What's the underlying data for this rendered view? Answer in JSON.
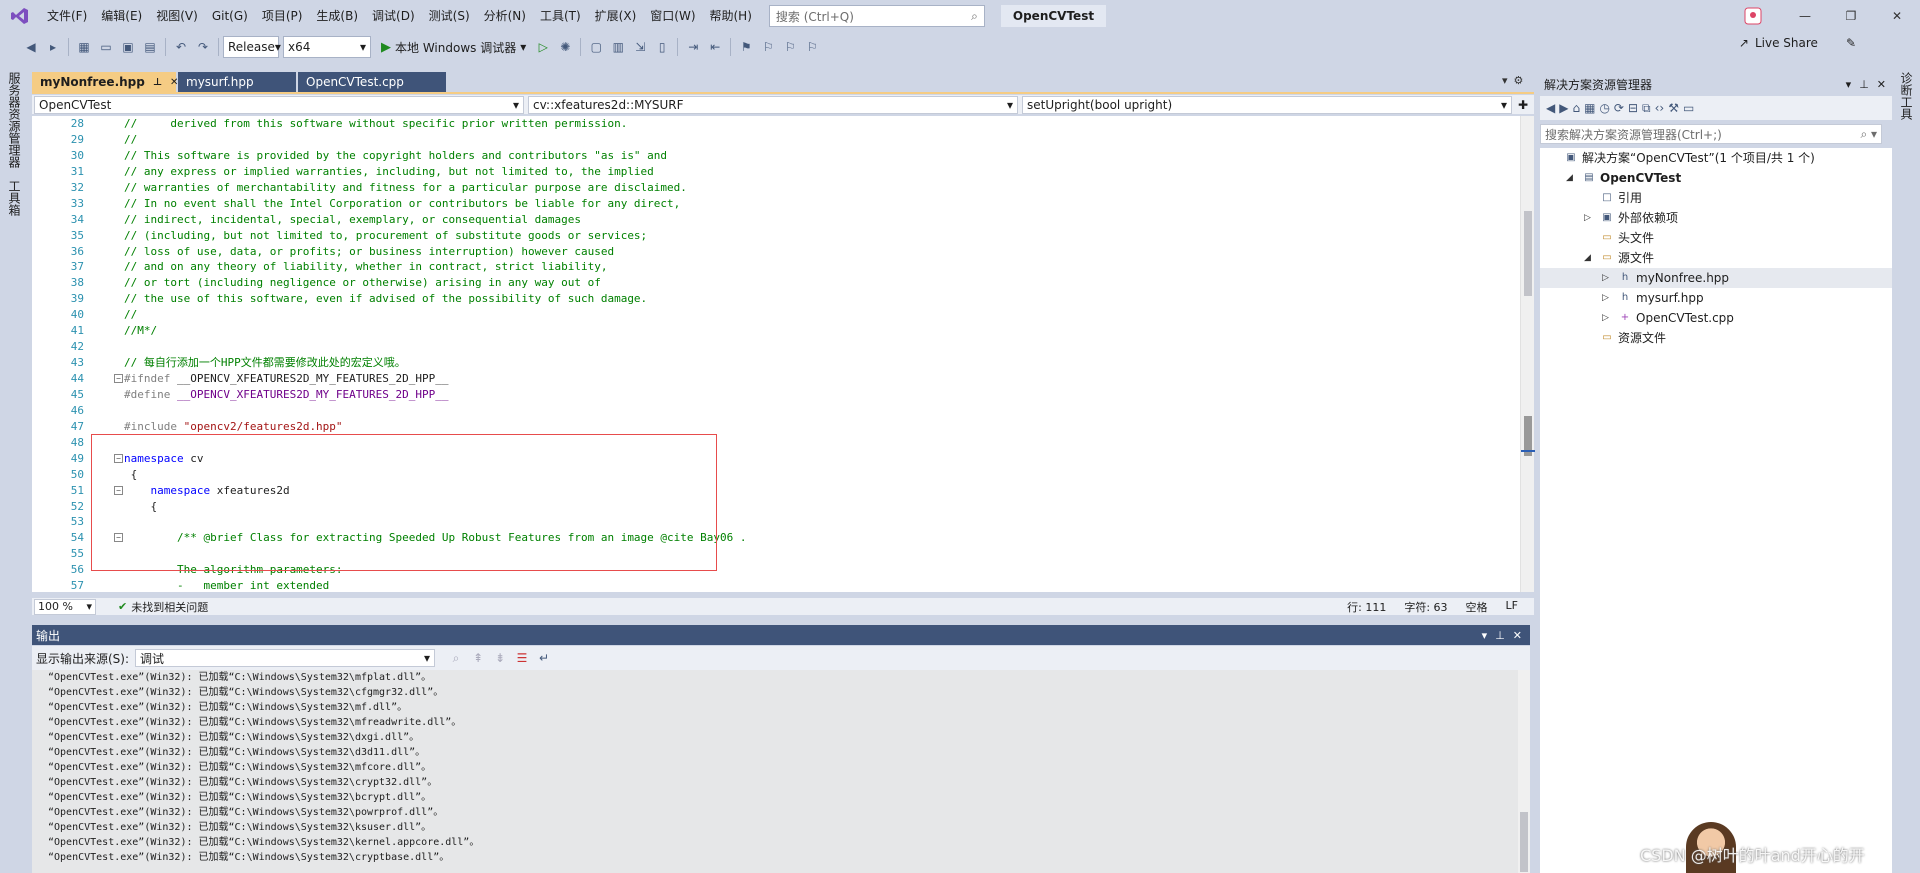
{
  "menubar": {
    "items": [
      "文件(F)",
      "编辑(E)",
      "视图(V)",
      "Git(G)",
      "项目(P)",
      "生成(B)",
      "调试(D)",
      "测试(S)",
      "分析(N)",
      "工具(T)",
      "扩展(X)",
      "窗口(W)",
      "帮助(H)"
    ],
    "search_placeholder": "搜索 (Ctrl+Q)",
    "solution_name": "OpenCVTest"
  },
  "toolbar": {
    "configuration": "Release",
    "platform": "x64",
    "run_label": "本地 Windows 调试器",
    "live_share": "Live Share"
  },
  "left_strip": {
    "tabs": [
      "服务器资源管理器",
      "工具箱"
    ]
  },
  "right_strip": {
    "tabs": [
      "诊断工具"
    ]
  },
  "editor": {
    "tabs": [
      {
        "label": "myNonfree.hpp",
        "active": true
      },
      {
        "label": "mysurf.hpp",
        "active": false
      },
      {
        "label": "OpenCVTest.cpp",
        "active": false
      }
    ],
    "nav": {
      "project": "OpenCVTest",
      "scope": "cv::xfeatures2d::MYSURF",
      "member": "setUpright(bool upright)"
    },
    "lines": [
      {
        "n": "28",
        "parts": [
          {
            "t": "//     derived from this software without specific prior written permission.",
            "c": "c-comment"
          }
        ]
      },
      {
        "n": "29",
        "parts": [
          {
            "t": "//",
            "c": "c-comment"
          }
        ]
      },
      {
        "n": "30",
        "parts": [
          {
            "t": "// This software is provided by the copyright holders and contributors \"as is\" and",
            "c": "c-comment"
          }
        ]
      },
      {
        "n": "31",
        "parts": [
          {
            "t": "// any express or implied warranties, including, but not limited to, the implied",
            "c": "c-comment"
          }
        ]
      },
      {
        "n": "32",
        "parts": [
          {
            "t": "// warranties of merchantability and fitness for a particular purpose are disclaimed.",
            "c": "c-comment"
          }
        ]
      },
      {
        "n": "33",
        "parts": [
          {
            "t": "// In no event shall the Intel Corporation or contributors be liable for any direct,",
            "c": "c-comment"
          }
        ]
      },
      {
        "n": "34",
        "parts": [
          {
            "t": "// indirect, incidental, special, exemplary, or consequential damages",
            "c": "c-comment"
          }
        ]
      },
      {
        "n": "35",
        "parts": [
          {
            "t": "// (including, but not limited to, procurement of substitute goods or services;",
            "c": "c-comment"
          }
        ]
      },
      {
        "n": "36",
        "parts": [
          {
            "t": "// loss of use, data, or profits; or business interruption) however caused",
            "c": "c-comment"
          }
        ]
      },
      {
        "n": "37",
        "parts": [
          {
            "t": "// and on any theory of liability, whether in contract, strict liability,",
            "c": "c-comment"
          }
        ]
      },
      {
        "n": "38",
        "parts": [
          {
            "t": "// or tort (including negligence or otherwise) arising in any way out of",
            "c": "c-comment"
          }
        ]
      },
      {
        "n": "39",
        "parts": [
          {
            "t": "// the use of this software, even if advised of the possibility of such damage.",
            "c": "c-comment"
          }
        ]
      },
      {
        "n": "40",
        "parts": [
          {
            "t": "//",
            "c": "c-comment"
          }
        ]
      },
      {
        "n": "41",
        "parts": [
          {
            "t": "//M*/",
            "c": "c-comment"
          }
        ]
      },
      {
        "n": "42",
        "parts": []
      },
      {
        "n": "43",
        "parts": [
          {
            "t": "// 每自行添加一个HPP文件都需要修改此处的宏定义哦。",
            "c": "c-comment"
          }
        ]
      },
      {
        "n": "44",
        "fold": "−",
        "parts": [
          {
            "t": "#ifndef ",
            "c": "c-pre"
          },
          {
            "t": "__OPENCV_XFEATURES2D_MY_FEATURES_2D_HPP__",
            "c": ""
          }
        ]
      },
      {
        "n": "45",
        "parts": [
          {
            "t": "#define ",
            "c": "c-pre"
          },
          {
            "t": "__OPENCV_XFEATURES2D_MY_FEATURES_2D_HPP__",
            "c": "c-macro"
          }
        ]
      },
      {
        "n": "46",
        "parts": []
      },
      {
        "n": "47",
        "parts": [
          {
            "t": "#include ",
            "c": "c-pre"
          },
          {
            "t": "\"opencv2/features2d.hpp\"",
            "c": "c-str"
          }
        ]
      },
      {
        "n": "48",
        "parts": []
      },
      {
        "n": "49",
        "fold": "−",
        "parts": [
          {
            "t": "namespace ",
            "c": "c-kw"
          },
          {
            "t": "cv",
            "c": ""
          }
        ]
      },
      {
        "n": "50",
        "parts": [
          {
            "t": " {",
            "c": ""
          }
        ]
      },
      {
        "n": "51",
        "fold": "−",
        "parts": [
          {
            "t": "    namespace ",
            "c": "c-kw"
          },
          {
            "t": "xfeatures2d",
            "c": ""
          }
        ]
      },
      {
        "n": "52",
        "parts": [
          {
            "t": "    {",
            "c": ""
          }
        ]
      },
      {
        "n": "53",
        "parts": []
      },
      {
        "n": "54",
        "fold": "−",
        "parts": [
          {
            "t": "        /** @brief Class for extracting Speeded Up Robust Features from an image @cite Bay06 .",
            "c": "c-doc"
          }
        ]
      },
      {
        "n": "55",
        "parts": []
      },
      {
        "n": "56",
        "parts": [
          {
            "t": "        The algorithm parameters:",
            "c": "c-doc"
          }
        ]
      },
      {
        "n": "57",
        "parts": [
          {
            "t": "        -   member int extended",
            "c": "c-doc"
          }
        ]
      }
    ],
    "status": {
      "zoom": "100 %",
      "issues": "未找到相关问题",
      "line": "行: 111",
      "col": "字符: 63",
      "ws": "空格",
      "eol": "LF"
    }
  },
  "output": {
    "title": "输出",
    "source_label": "显示输出来源(S):",
    "source_value": "调试",
    "lines": [
      "“OpenCVTest.exe”(Win32): 已加载“C:\\Windows\\System32\\mfplat.dll”。",
      "“OpenCVTest.exe”(Win32): 已加载“C:\\Windows\\System32\\cfgmgr32.dll”。",
      "“OpenCVTest.exe”(Win32): 已加载“C:\\Windows\\System32\\mf.dll”。",
      "“OpenCVTest.exe”(Win32): 已加载“C:\\Windows\\System32\\mfreadwrite.dll”。",
      "“OpenCVTest.exe”(Win32): 已加载“C:\\Windows\\System32\\dxgi.dll”。",
      "“OpenCVTest.exe”(Win32): 已加载“C:\\Windows\\System32\\d3d11.dll”。",
      "“OpenCVTest.exe”(Win32): 已加载“C:\\Windows\\System32\\mfcore.dll”。",
      "“OpenCVTest.exe”(Win32): 已加载“C:\\Windows\\System32\\crypt32.dll”。",
      "“OpenCVTest.exe”(Win32): 已加载“C:\\Windows\\System32\\bcrypt.dll”。",
      "“OpenCVTest.exe”(Win32): 已加载“C:\\Windows\\System32\\powrprof.dll”。",
      "“OpenCVTest.exe”(Win32): 已加载“C:\\Windows\\System32\\ksuser.dll”。",
      "“OpenCVTest.exe”(Win32): 已加载“C:\\Windows\\System32\\kernel.appcore.dll”。",
      "“OpenCVTest.exe”(Win32): 已加载“C:\\Windows\\System32\\cryptbase.dll”。"
    ]
  },
  "solution_explorer": {
    "title": "解决方案资源管理器",
    "search_placeholder": "搜索解决方案资源管理器(Ctrl+;)",
    "tree": [
      {
        "label": "解决方案“OpenCVTest”(1 个项目/共 1 个)",
        "level": 0,
        "arrow": "",
        "icon": "solution-icon",
        "glyph": "▣",
        "bold": false
      },
      {
        "label": "OpenCVTest",
        "level": 1,
        "arrow": "◢",
        "icon": "project-icon",
        "glyph": "▤",
        "bold": true
      },
      {
        "label": "引用",
        "level": 2,
        "arrow": "",
        "icon": "references-icon",
        "glyph": "□",
        "bold": false
      },
      {
        "label": "外部依赖项",
        "level": 2,
        "arrow": "▷",
        "icon": "external-deps-icon",
        "glyph": "▣",
        "bold": false
      },
      {
        "label": "头文件",
        "level": 2,
        "arrow": "",
        "icon": "folder-icon",
        "glyph": "▭",
        "bold": false
      },
      {
        "label": "源文件",
        "level": 2,
        "arrow": "◢",
        "icon": "folder-icon",
        "glyph": "▭",
        "bold": false
      },
      {
        "label": "myNonfree.hpp",
        "level": 3,
        "arrow": "▷",
        "icon": "header-file-icon",
        "glyph": "h",
        "bold": false,
        "selected": true
      },
      {
        "label": "mysurf.hpp",
        "level": 3,
        "arrow": "▷",
        "icon": "header-file-icon",
        "glyph": "h",
        "bold": false
      },
      {
        "label": "OpenCVTest.cpp",
        "level": 3,
        "arrow": "▷",
        "icon": "cpp-file-icon",
        "glyph": "+",
        "bold": false
      },
      {
        "label": "资源文件",
        "level": 2,
        "arrow": "",
        "icon": "folder-icon",
        "glyph": "▭",
        "bold": false
      }
    ]
  },
  "watermark": "CSDN @树叶的叶and开心的开",
  "colors": {
    "chrome": "#cfd6e5",
    "active_tab": "#f5cc84",
    "panel_header": "#3f5479",
    "highlight_box": "#e74c4c"
  }
}
